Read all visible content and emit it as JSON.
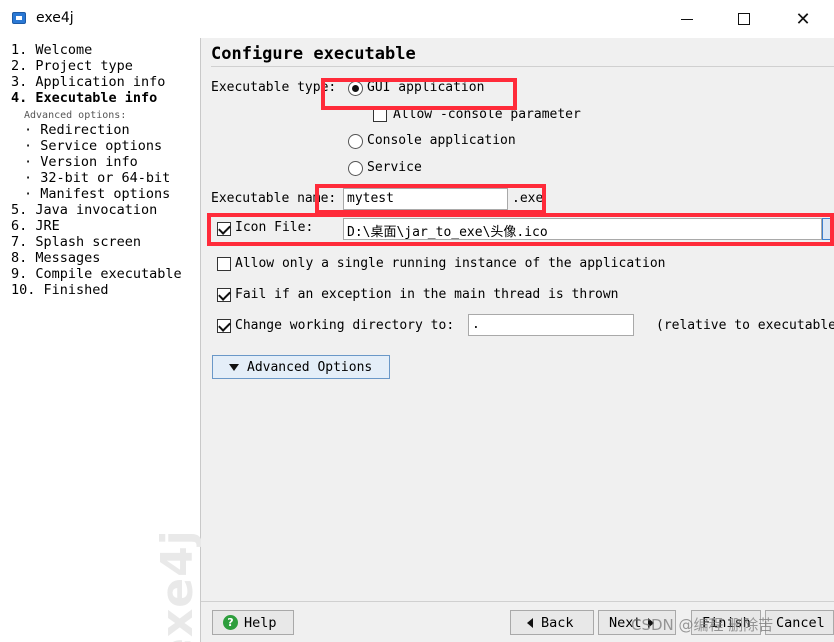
{
  "window": {
    "title": "exe4j",
    "icon": "exe4j-app-icon",
    "controls": [
      "minimize-icon",
      "maximize-icon",
      "close-icon"
    ]
  },
  "sidebar": {
    "watermark": "exe4j",
    "steps": [
      {
        "label": "1.  Welcome",
        "active": false
      },
      {
        "label": "2.  Project type",
        "active": false
      },
      {
        "label": "3.  Application info",
        "active": false
      },
      {
        "label": "4.  Executable info",
        "active": true
      },
      {
        "label": "Advanced options:",
        "kind": "header"
      },
      {
        "label": "· Redirection",
        "kind": "sub"
      },
      {
        "label": "· Service options",
        "kind": "sub"
      },
      {
        "label": "· Version info",
        "kind": "sub"
      },
      {
        "label": "· 32-bit or 64-bit",
        "kind": "sub"
      },
      {
        "label": "· Manifest options",
        "kind": "sub"
      },
      {
        "label": "5.  Java invocation",
        "active": false
      },
      {
        "label": "6.  JRE",
        "active": false
      },
      {
        "label": "7.  Splash screen",
        "active": false
      },
      {
        "label": "8.  Messages",
        "active": false
      },
      {
        "label": "9.  Compile executable",
        "active": false
      },
      {
        "label": "10.  Finished",
        "active": false
      }
    ]
  },
  "main": {
    "header": "Configure executable",
    "executable_type": {
      "label": "Executable type:",
      "options": [
        {
          "label": "GUI application",
          "selected": true
        },
        {
          "label": "Console application",
          "selected": false
        },
        {
          "label": "Service",
          "selected": false
        }
      ],
      "allow_console": {
        "label": "Allow -console parameter",
        "checked": false
      }
    },
    "executable_name": {
      "label": "Executable name:",
      "value": "mytest",
      "suffix": ".exe"
    },
    "icon_file": {
      "label": "Icon File:",
      "checked": true,
      "value": "D:\\桌面\\jar_to_exe\\头像.ico"
    },
    "single_instance": {
      "label": "Allow only a single running instance of the application",
      "checked": false
    },
    "fail_exception": {
      "label": "Fail if an exception in the main thread is thrown",
      "checked": true
    },
    "working_dir": {
      "label": "Change working directory to:",
      "checked": true,
      "value": ".",
      "note": "(relative to executable"
    },
    "advanced_button": "Advanced Options"
  },
  "footer": {
    "help": "Help",
    "back": "Back",
    "next": "Next",
    "finish": "Finish",
    "cancel": "Cancel",
    "overlay_text": "CSDN @编程 删除苦"
  },
  "colors": {
    "highlight_box": "#ff2b3a",
    "panel_bg": "#f0f0f0",
    "help_icon": "#2e9e3d"
  }
}
